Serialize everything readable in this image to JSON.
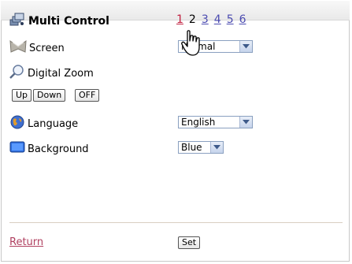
{
  "header": {
    "title": "Multi Control",
    "pages": [
      "1",
      "2",
      "3",
      "4",
      "5",
      "6"
    ]
  },
  "settings": {
    "screen_label": "Screen",
    "screen_value": "Normal",
    "digital_zoom_label": "Digital Zoom",
    "zoom_buttons": {
      "up": "Up",
      "down": "Down",
      "off": "OFF"
    },
    "language_label": "Language",
    "language_value": "English",
    "background_label": "Background",
    "background_value": "Blue"
  },
  "footer": {
    "return_label": "Return",
    "set_label": "Set"
  },
  "icons": {
    "title": "multi-control-icon",
    "screen": "screen-icon",
    "zoom": "magnifier-icon",
    "language": "globe-icon",
    "background": "monitor-icon",
    "cursor": "hand-pointer-icon"
  },
  "colors": {
    "link": "#4a4ab0",
    "active_link": "#c02040",
    "return_link": "#b04060"
  }
}
